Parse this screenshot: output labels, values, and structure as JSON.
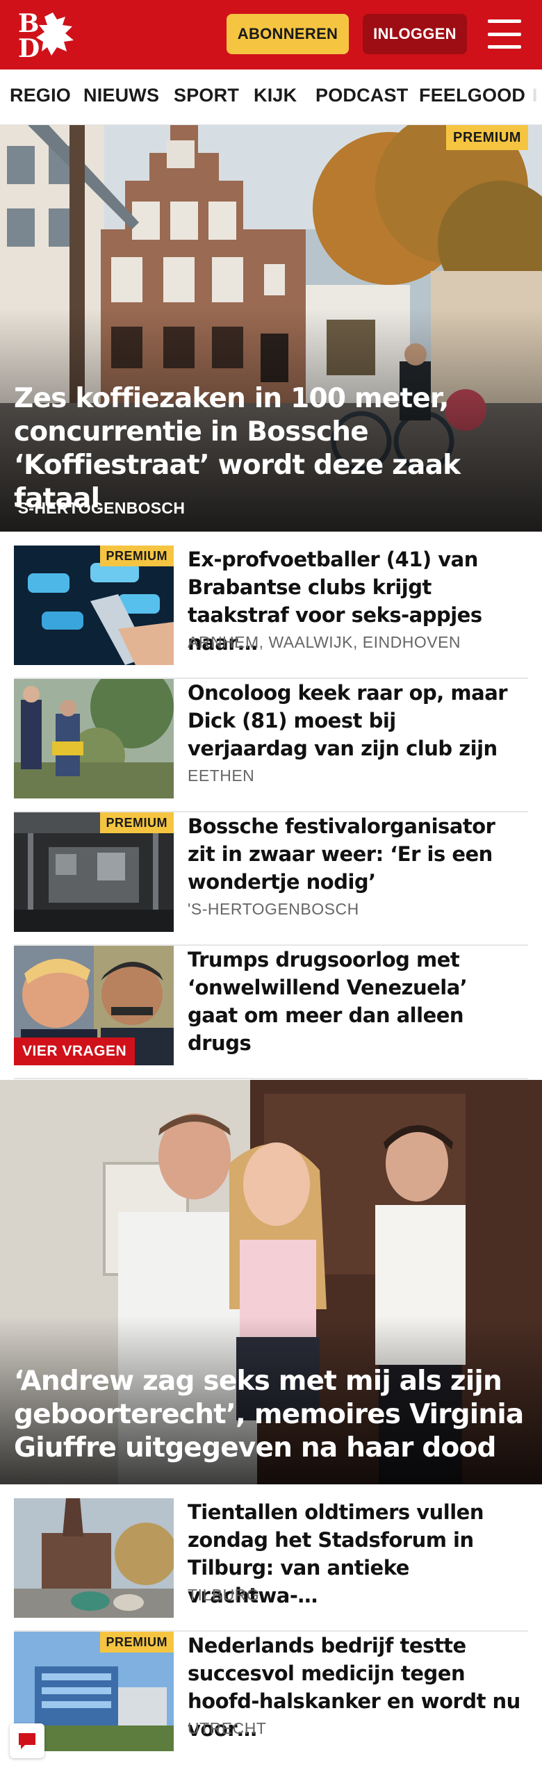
{
  "header": {
    "logo_text": "BD",
    "subscribe_label": "ABONNEREN",
    "login_label": "INLOGGEN",
    "menu_icon": "hamburger-menu-icon",
    "brand_color": "#d0111a"
  },
  "nav": {
    "items": [
      "REGIO",
      "NIEUWS",
      "SPORT",
      "KIJK",
      "PODCAST",
      "FEELGOOD",
      "I"
    ]
  },
  "hero": {
    "premium": "PREMIUM",
    "title": "Zes koffiezaken in 100 meter, concurrentie in Bossche ‘Koffiestraat’ wordt deze zaak fataal",
    "location": "'S-HERTOGENBOSCH"
  },
  "articles": [
    {
      "premium": "PREMIUM",
      "title": "Ex-profvoetballer (41) van Brabantse clubs krijgt taakstraf voor seks-appjes naar…",
      "location": "ARNHEM, WAALWIJK, EINDHOVEN"
    },
    {
      "title": "Oncoloog keek raar op, maar Dick (81) moest bij verjaardag van zijn club zijn",
      "location": "EETHEN"
    },
    {
      "premium": "PREMIUM",
      "title": "Bossche festivalorganisator zit in zwaar weer: ‘Er is een wondertje nodig’",
      "location": "'S-HERTOGENBOSCH"
    },
    {
      "badge": "VIER VRAGEN",
      "title": "Trumps drugsoorlog met ‘onwelwillend Venezuela’ gaat om meer dan alleen drugs"
    }
  ],
  "big_story": {
    "title": "‘Andrew zag seks met mij als zijn geboorterecht’, memoires Virginia Giuffre uitgegeven na haar dood"
  },
  "articles2": [
    {
      "title": "Tientallen oldtimers vullen zondag het Stadsforum in Tilburg: van antieke vrachtwa-…",
      "location": "TILBURG"
    },
    {
      "premium": "PREMIUM",
      "title": "Nederlands bedrijf testte succesvol medicijn tegen hoofd-halskanker en wordt nu voor…",
      "location": "UTRECHT"
    }
  ],
  "chat": {
    "icon": "chat-bubble-icon"
  }
}
